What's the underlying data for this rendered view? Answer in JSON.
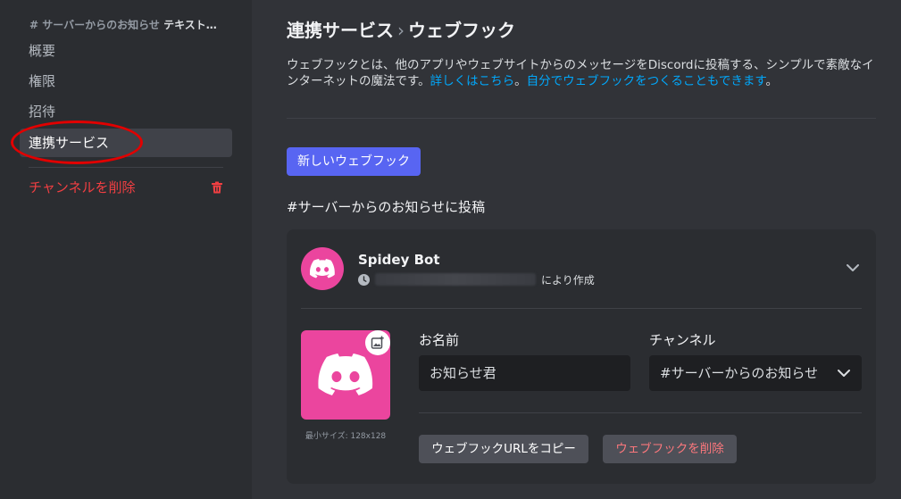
{
  "sidebar": {
    "header_channel": "# サーバーからのお知らせ",
    "header_category": "テキスト…",
    "items": [
      {
        "label": "概要"
      },
      {
        "label": "権限"
      },
      {
        "label": "招待"
      },
      {
        "label": "連携サービス"
      }
    ],
    "delete_label": "チャンネルを削除"
  },
  "main": {
    "breadcrumb_parent": "連携サービス",
    "breadcrumb_sep": "›",
    "breadcrumb_current": "ウェブフック",
    "desc_text": "ウェブフックとは、他のアプリやウェブサイトからのメッセージをDiscordに投稿する、シンプルで素敵なインターネットの魔法です。",
    "desc_link1": "詳しくはこちら",
    "desc_mid": "。",
    "desc_link2": "自分でウェブフックをつくることもできます",
    "desc_end": "。",
    "new_webhook_label": "新しいウェブフック",
    "section_title": "#サーバーからのお知らせに投稿"
  },
  "webhook": {
    "bot_name": "Spidey Bot",
    "created_by_suffix": "により作成",
    "min_size_label": "最小サイズ: 128x128",
    "name_label": "お名前",
    "name_value": "お知らせ君",
    "channel_label": "チャンネル",
    "channel_value": "#サーバーからのお知らせ",
    "copy_url_label": "ウェブフックURLをコピー",
    "delete_label": "ウェブフックを削除"
  },
  "colors": {
    "accent": "#5865f2",
    "avatar": "#eb459e",
    "danger": "#f23f42",
    "annotation": "#e10000"
  }
}
